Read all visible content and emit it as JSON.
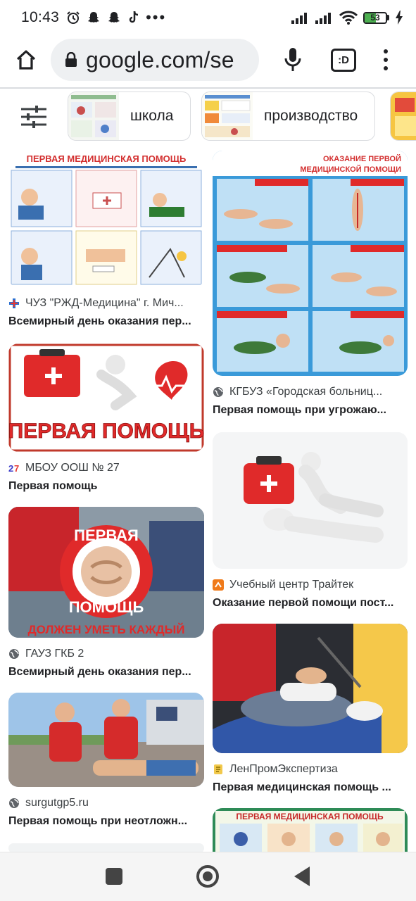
{
  "status_bar": {
    "time": "10:43",
    "battery": "53",
    "battery_level": 0.53,
    "icons": [
      "alarm-icon",
      "snapchat-icon",
      "snapchat-icon",
      "tiktok-icon",
      "more-dots-icon",
      "signal-icon",
      "signal-icon",
      "wifi-icon",
      "battery-icon",
      "charging-icon"
    ]
  },
  "toolbar": {
    "url": "google.com/se",
    "tab_count": ":D",
    "icons": [
      "home-icon",
      "lock-icon",
      "mic-icon",
      "tabs-icon",
      "overflow-menu-icon"
    ]
  },
  "chips": [
    {
      "label": "школа"
    },
    {
      "label": "производство"
    }
  ],
  "results": [
    {
      "source": "ЧУЗ \"РЖД-Медицина\" г. Мич...",
      "title": "Всемирный день оказания пер...",
      "image_text": "ПЕРВАЯ МЕДИЦИНСКАЯ ПОМОЩЬ",
      "source_icon": "rzd-medicine-icon"
    },
    {
      "source": "КГБУЗ «Городская больниц...",
      "title": "Первая помощь при угрожаю...",
      "image_text": "ОКАЗАНИЕ ПЕРВОЙ МЕДИЦИНСКОЙ ПОМОЩИ",
      "source_icon": "globe-icon"
    },
    {
      "source": "МБОУ ООШ № 27",
      "title": "Первая помощь",
      "image_text": "ПЕРВАЯ ПОМОЩЬ",
      "source_icon": "school-27-icon"
    },
    {
      "source": "Учебный центр Трайтек",
      "title": "Оказание первой помощи пост...",
      "image_text": "",
      "source_icon": "traitek-icon"
    },
    {
      "source": "ГАУЗ ГКБ 2",
      "title": "Всемирный день оказания пер...",
      "image_text_top": "ПЕРВАЯ",
      "image_text_bottom": "ПОМОЩЬ",
      "image_caption": "ДОЛЖЕН УМЕТЬ КАЖДЫЙ",
      "source_icon": "globe-icon"
    },
    {
      "source": "ЛенПромЭкспертиза",
      "title": "Первая медицинская помощь ...",
      "image_text": "",
      "source_icon": "lenprom-icon"
    },
    {
      "source": "surgutgp5.ru",
      "title": "Первая помощь при неотложн...",
      "image_text": "",
      "source_icon": "globe-icon"
    },
    {
      "source": "",
      "title": "",
      "image_text": "ПЕРВАЯ МЕДИЦИНСКАЯ ПОМОЩЬ",
      "source_icon": ""
    }
  ],
  "colors": {
    "accent_red": "#d32f2f",
    "poster_blue": "#3a9ad9",
    "navbar_bg": "#f5f5f5",
    "url_pill_bg": "#eef0f2"
  },
  "navbar": {
    "icons": [
      "recents-square-icon",
      "home-circle-icon",
      "back-triangle-icon"
    ]
  }
}
